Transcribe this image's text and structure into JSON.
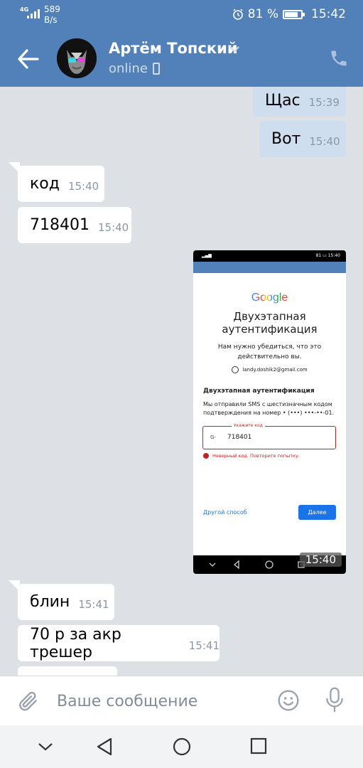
{
  "status_bar": {
    "network": "4G",
    "speed_value": "589",
    "speed_unit": "B/s",
    "battery": "81 %",
    "time": "15:42"
  },
  "header": {
    "contact_name": "Артём Топский",
    "status": "online"
  },
  "messages": [
    {
      "direction": "out",
      "text": "Щас",
      "time": "15:39"
    },
    {
      "direction": "out",
      "text": "Вот",
      "time": "15:40"
    },
    {
      "direction": "in",
      "text": "код",
      "time": "15:40"
    },
    {
      "direction": "in",
      "text": "718401",
      "time": "15:40"
    },
    {
      "direction": "in",
      "text": "блин",
      "time": "15:41"
    },
    {
      "direction": "in",
      "text": "70 р за акр трешер",
      "time": "15:41"
    }
  ],
  "image_message": {
    "time": "15:40",
    "status_time": "15:40",
    "status_battery": "81",
    "google_logo": "Google",
    "title": "Двухэтапная аутентификация",
    "subtitle": "Нам нужно убедиться, что это действительно вы.",
    "account": "landy.doshik2@gmail.com",
    "section_title": "Двухэтапная аутентификация",
    "sms_text": "Мы отправили SMS с шестизначным кодом подтверждения на номер • (•••) •••-••-01.",
    "field_label": "Укажите код",
    "field_prefix": "G-",
    "field_value": "718401",
    "error": "Неверный код. Повторите попытку.",
    "other_method": "Другой способ",
    "next_button": "Далее"
  },
  "composer": {
    "placeholder": "Ваше сообщение"
  },
  "colors": {
    "header": "#5181b8",
    "outgoing_bubble": "#cfdeef",
    "incoming_bubble": "#ffffff",
    "chat_background": "#dde1e6"
  }
}
